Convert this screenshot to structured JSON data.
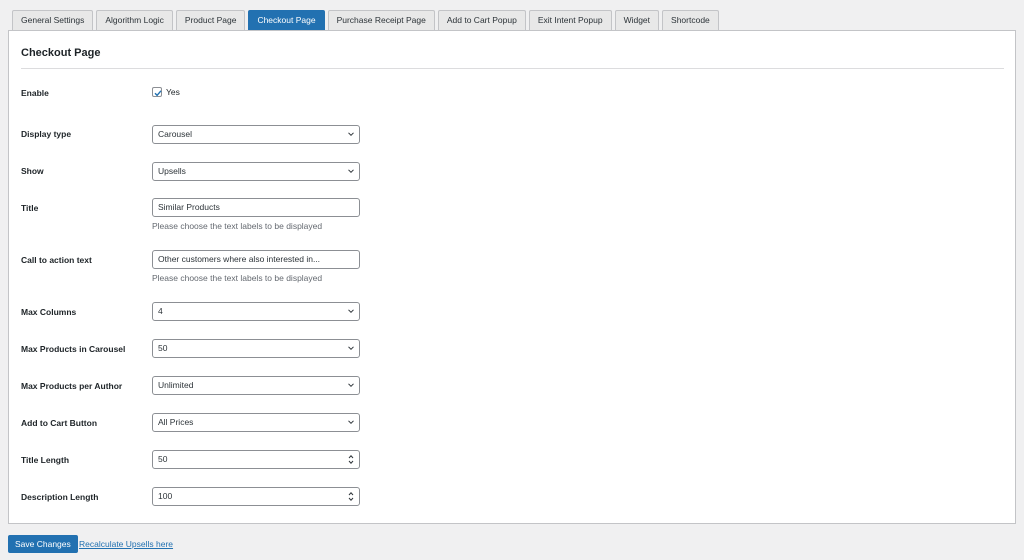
{
  "tabs": [
    {
      "label": "General Settings",
      "active": false
    },
    {
      "label": "Algorithm Logic",
      "active": false
    },
    {
      "label": "Product Page",
      "active": false
    },
    {
      "label": "Checkout Page",
      "active": true
    },
    {
      "label": "Purchase Receipt Page",
      "active": false
    },
    {
      "label": "Add to Cart Popup",
      "active": false
    },
    {
      "label": "Exit Intent Popup",
      "active": false
    },
    {
      "label": "Widget",
      "active": false
    },
    {
      "label": "Shortcode",
      "active": false
    }
  ],
  "section": {
    "title": "Checkout Page"
  },
  "fields": {
    "enable": {
      "label": "Enable",
      "checked": true,
      "option_label": "Yes"
    },
    "display_type": {
      "label": "Display type",
      "value": "Carousel"
    },
    "show": {
      "label": "Show",
      "value": "Upsells"
    },
    "title": {
      "label": "Title",
      "value": "Similar Products",
      "help": "Please choose the text labels to be displayed"
    },
    "cta_text": {
      "label": "Call to action text",
      "value": "Other customers where also interested in...",
      "help": "Please choose the text labels to be displayed"
    },
    "max_columns": {
      "label": "Max Columns",
      "value": "4"
    },
    "max_products_carousel": {
      "label": "Max Products in Carousel",
      "value": "50"
    },
    "max_products_author": {
      "label": "Max Products per Author",
      "value": "Unlimited"
    },
    "add_to_cart_button": {
      "label": "Add to Cart Button",
      "value": "All Prices"
    },
    "title_length": {
      "label": "Title Length",
      "value": "50"
    },
    "description_length": {
      "label": "Description Length",
      "value": "100"
    }
  },
  "footer": {
    "save_label": "Save Changes",
    "recalc_label": "Recalculate Upsells here"
  },
  "colors": {
    "accent": "#2271b1",
    "background": "#f0f0f1"
  }
}
